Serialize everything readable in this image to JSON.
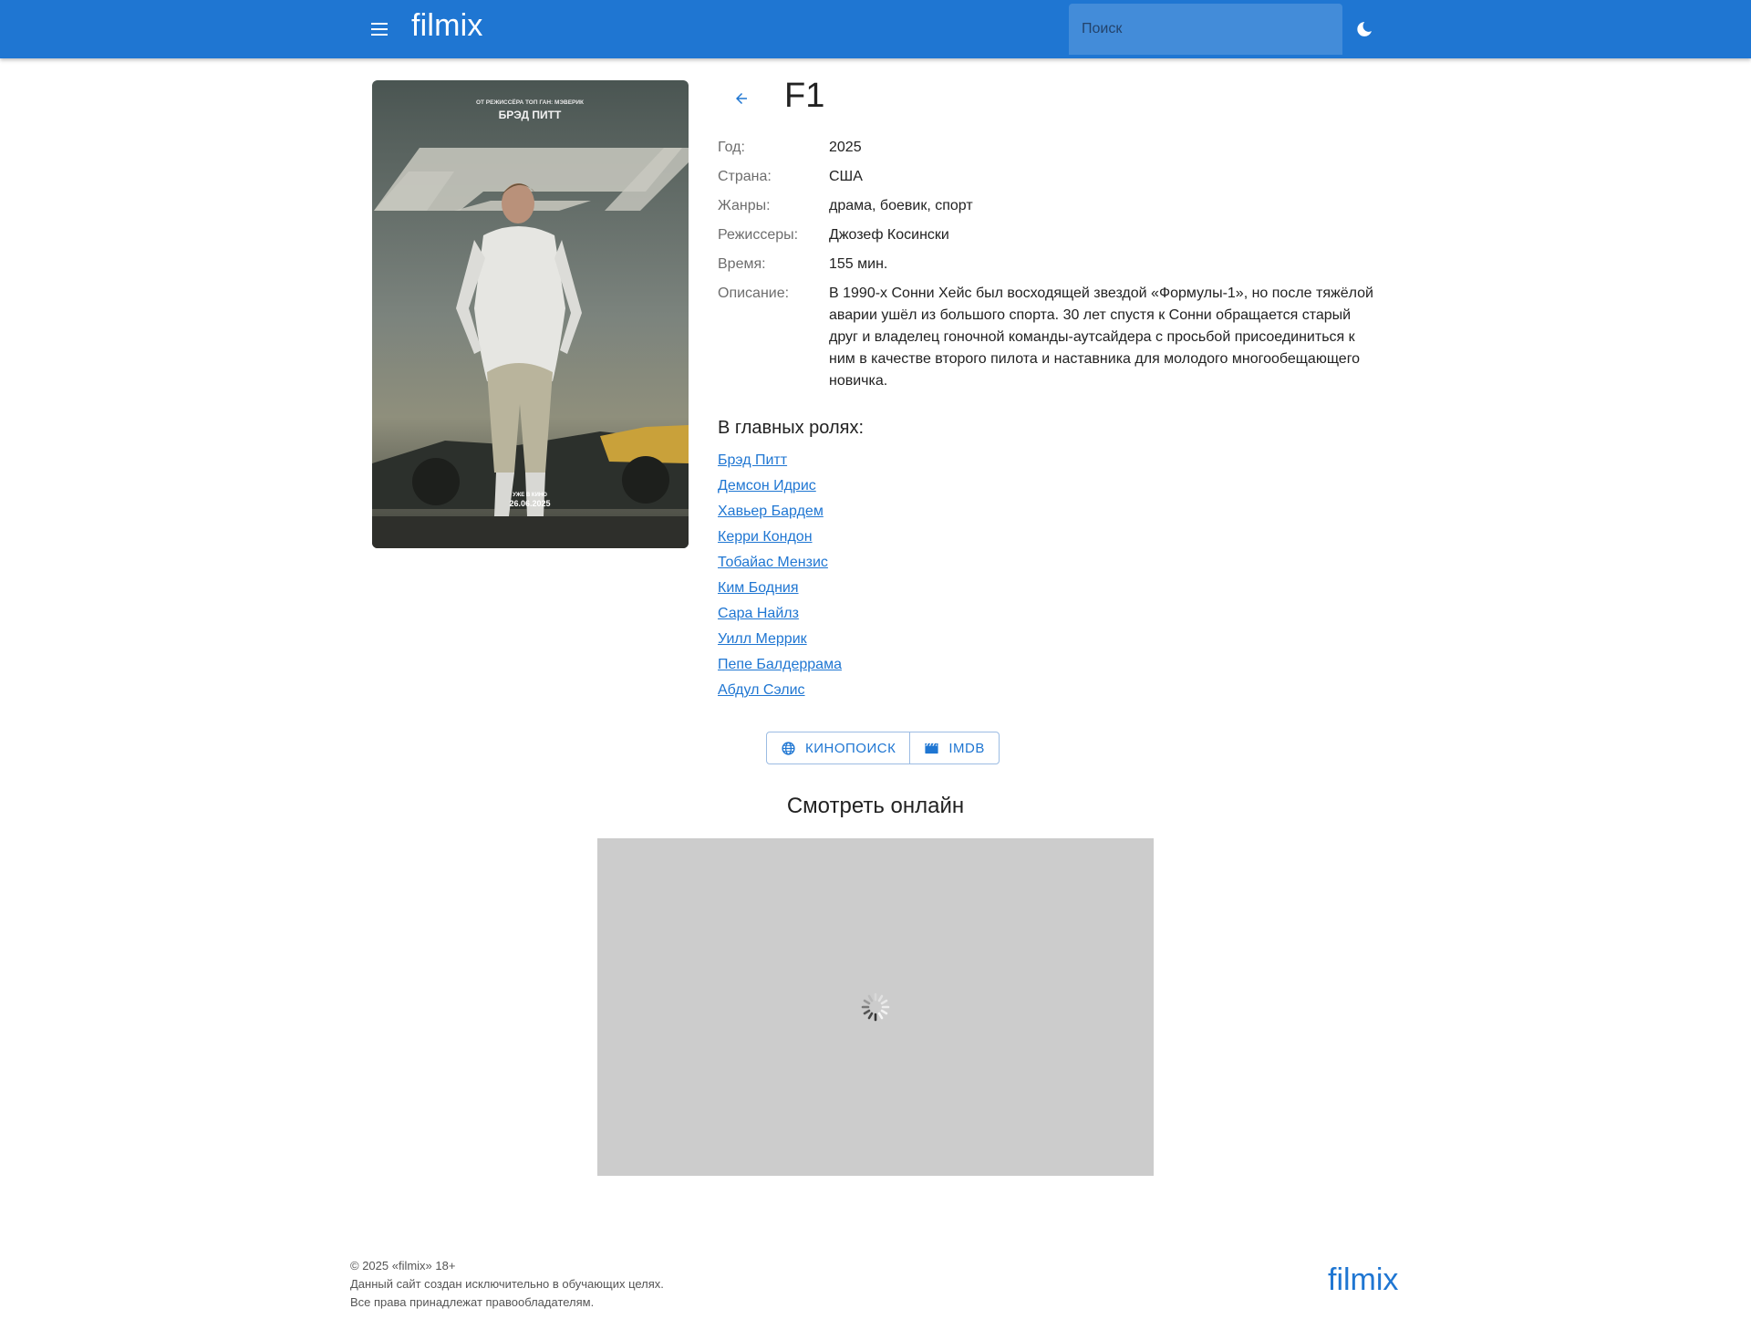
{
  "header": {
    "logo": "filmix",
    "search_placeholder": "Поиск",
    "menu_icon": "menu-icon",
    "theme_icon": "moon-icon"
  },
  "poster": {
    "top_text": "ОТ РЕЖИССЁРА ТОП ГАН: МЭВЕРИК",
    "actor_name": "БРЭД ПИТТ",
    "release_line": "УЖЕ В КИНО",
    "release_date": "26.06.2025"
  },
  "movie": {
    "title": "F1",
    "back_icon": "arrow-left-icon",
    "facts": [
      {
        "label": "Год:",
        "value": "2025"
      },
      {
        "label": "Страна:",
        "value": "США"
      },
      {
        "label": "Жанры:",
        "value": "драма, боевик, спорт"
      },
      {
        "label": "Режиссеры:",
        "value": "Джозеф Косински"
      },
      {
        "label": "Время:",
        "value": "155 мин."
      },
      {
        "label": "Описание:",
        "value": "В 1990-х Сонни Хейс был восходящей звездой «Формулы-1», но после тяжёлой аварии ушёл из большого спорта. 30 лет спустя к Сонни обращается старый друг и владелец гоночной команды-аутсайдера с просьбой присоединиться к ним в качестве второго пилота и наставника для молодого многообещающего новичка."
      }
    ],
    "cast_heading": "В главных ролях:",
    "cast": [
      "Брэд Питт",
      "Демсон Идрис",
      "Хавьер Бардем",
      "Керри Кондон",
      "Тобайас Мензис",
      "Ким Бодния",
      "Сара Найлз",
      "Уилл Меррик",
      "Пепе Балдеррама",
      "Абдул Сэлис"
    ]
  },
  "links": {
    "kinopoisk_label": "КИНОПОИСК",
    "kinopoisk_icon": "globe-icon",
    "imdb_label": "IMDB",
    "imdb_icon": "clapperboard-icon"
  },
  "player": {
    "heading": "Смотреть онлайн",
    "status_icon": "loading-spinner-icon"
  },
  "footer": {
    "line1": "© 2025 «filmix» 18+",
    "line2": "Данный сайт создан исключительно в обучающих целях.",
    "line3": "Все права принадлежат правообладателям.",
    "logo": "filmix"
  },
  "colors": {
    "primary": "#1f76d2",
    "player_bg": "#cccccc"
  }
}
